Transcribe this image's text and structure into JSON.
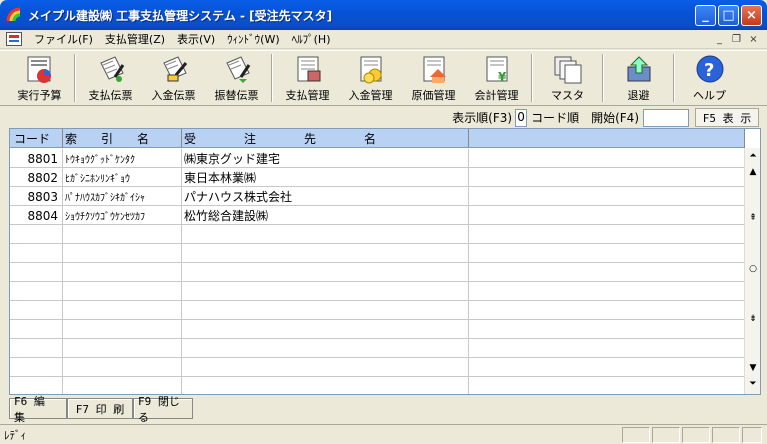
{
  "window": {
    "title": "メイプル建設㈱ 工事支払管理システム - [受注先マスタ]",
    "minimize": "_",
    "maximize": "□",
    "close": "×"
  },
  "menu": {
    "items": [
      "ファイル(F)",
      "支払管理(Z)",
      "表示(V)",
      "ｳｨﾝﾄﾞｳ(W)",
      "ﾍﾙﾌﾟ(H)"
    ],
    "mdi_min": "_",
    "mdi_restore": "❐",
    "mdi_close": "×"
  },
  "toolbar": {
    "items": [
      "実行予算",
      "支払伝票",
      "入金伝票",
      "振替伝票",
      "支払管理",
      "入金管理",
      "原価管理",
      "会計管理",
      "マスタ",
      "退避",
      "ヘルプ"
    ]
  },
  "sort": {
    "order_label": "表示順(F3)",
    "order_value": "0",
    "order_text": "コード順",
    "start_label": "開始(F4)",
    "start_value": "",
    "f5_label": "F5 表 示"
  },
  "grid": {
    "headers": [
      "コード",
      "索　　引　　名",
      "受　　　　注　　　　先　　　　名"
    ],
    "rows": [
      {
        "code": "8801",
        "kana": "ﾄｳｷｮｳｸﾞｯﾄﾞｹﾝﾀｸ",
        "name": "㈱東京グッド建宅"
      },
      {
        "code": "8802",
        "kana": "ﾋｶﾞｼﾆﾎﾝﾘﾝｷﾞｮｳ",
        "name": "東日本林業㈱"
      },
      {
        "code": "8803",
        "kana": "ﾊﾟﾅﾊｳｽｶﾌﾞｼｷｶﾞｲｼｬ",
        "name": "パナハウス株式会社"
      },
      {
        "code": "8804",
        "kana": "ｼｮｳﾁｸｿｳｺﾞｳｹﾝｾﾂｶﾌ",
        "name": "松竹総合建設㈱"
      }
    ]
  },
  "buttons": {
    "edit": "F6 編 集",
    "print": "F7 印 刷",
    "close": "F9 閉じる"
  },
  "status": {
    "text": "ﾚﾃﾞｨ"
  },
  "colors": {
    "titlebar": "#0a5de8",
    "header": "#b9d1f3",
    "chrome": "#ece9d8"
  }
}
